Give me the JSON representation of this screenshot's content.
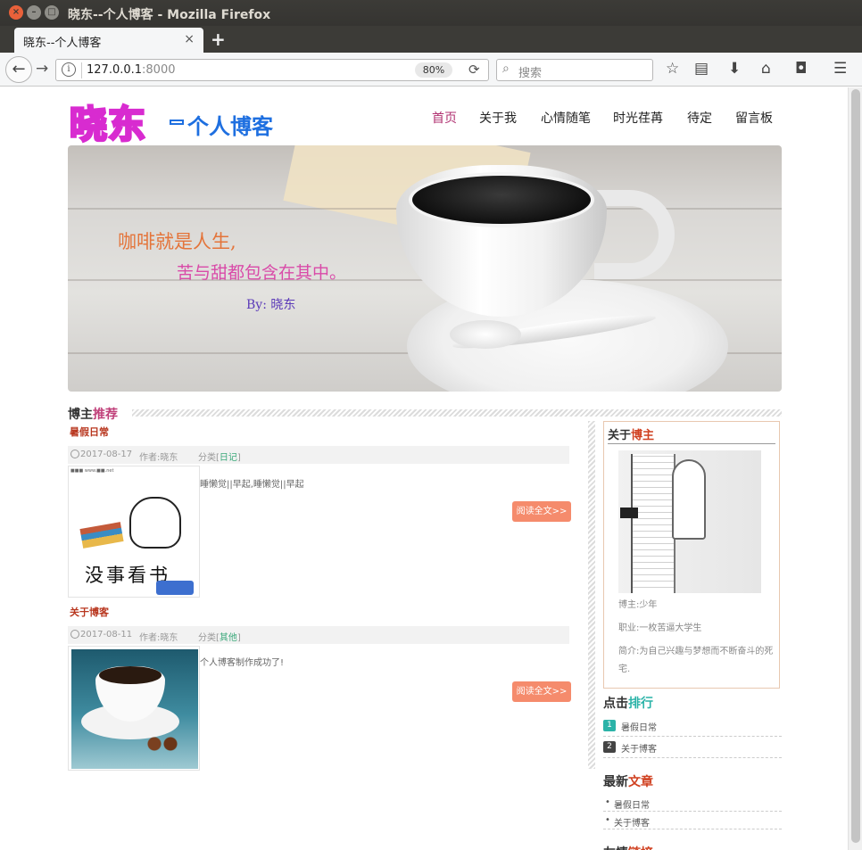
{
  "window": {
    "title": "晓东--个人博客 - Mozilla Firefox"
  },
  "tab": {
    "title": "晓东--个人博客",
    "close": "×",
    "new_tab": "+"
  },
  "navbar": {
    "url_host": "127.0.0.1",
    "url_port": ":8000",
    "zoom": "80%",
    "search_placeholder": "搜索"
  },
  "site": {
    "logo_main": "晓东",
    "logo_sub": "个人博客",
    "nav": [
      {
        "label": "首页",
        "active": true
      },
      {
        "label": "关于我"
      },
      {
        "label": "心情随笔"
      },
      {
        "label": "时光荏苒"
      },
      {
        "label": "待定"
      },
      {
        "label": "留言板"
      }
    ]
  },
  "banner": {
    "line1": "咖啡就是人生,",
    "line2": "苦与甜都包含在其中。",
    "line3": "By: 晓东"
  },
  "recommend": {
    "title_a": "博主",
    "title_b": "推荐"
  },
  "posts": [
    {
      "title": "暑假日常",
      "date": "2017-08-17",
      "author": "作者:晓东",
      "category_prefix": "分类[",
      "category": "日记",
      "category_suffix": "]",
      "excerpt": "睡懒觉||早起,睡懒觉||早起",
      "read_more": "阅读全文>>",
      "thumb_text": "没事看书"
    },
    {
      "title": "关于博客",
      "date": "2017-08-11",
      "author": "作者:晓东",
      "category_prefix": "分类[",
      "category": "其他",
      "category_suffix": "]",
      "excerpt": "个人博客制作成功了!",
      "read_more": "阅读全文>>"
    }
  ],
  "about": {
    "title_a": "关于",
    "title_b": "博主",
    "blogger": "博主:少年",
    "job": "职业:一枚苦逼大学生",
    "intro_1": "简介:为自己兴趣与梦想而不断奋斗的死",
    "intro_2": "宅."
  },
  "ranking": {
    "title_a": "点击",
    "title_b": "排行",
    "items": [
      {
        "num": "1",
        "label": "暑假日常",
        "color": "#2bb3a8"
      },
      {
        "num": "2",
        "label": "关于博客",
        "color": "#444444"
      }
    ]
  },
  "latest": {
    "title_a": "最新",
    "title_b": "文章",
    "items": [
      {
        "label": "暑假日常"
      },
      {
        "label": "关于博客"
      }
    ]
  },
  "links": {
    "title_a": "友情",
    "title_b": "链接"
  }
}
